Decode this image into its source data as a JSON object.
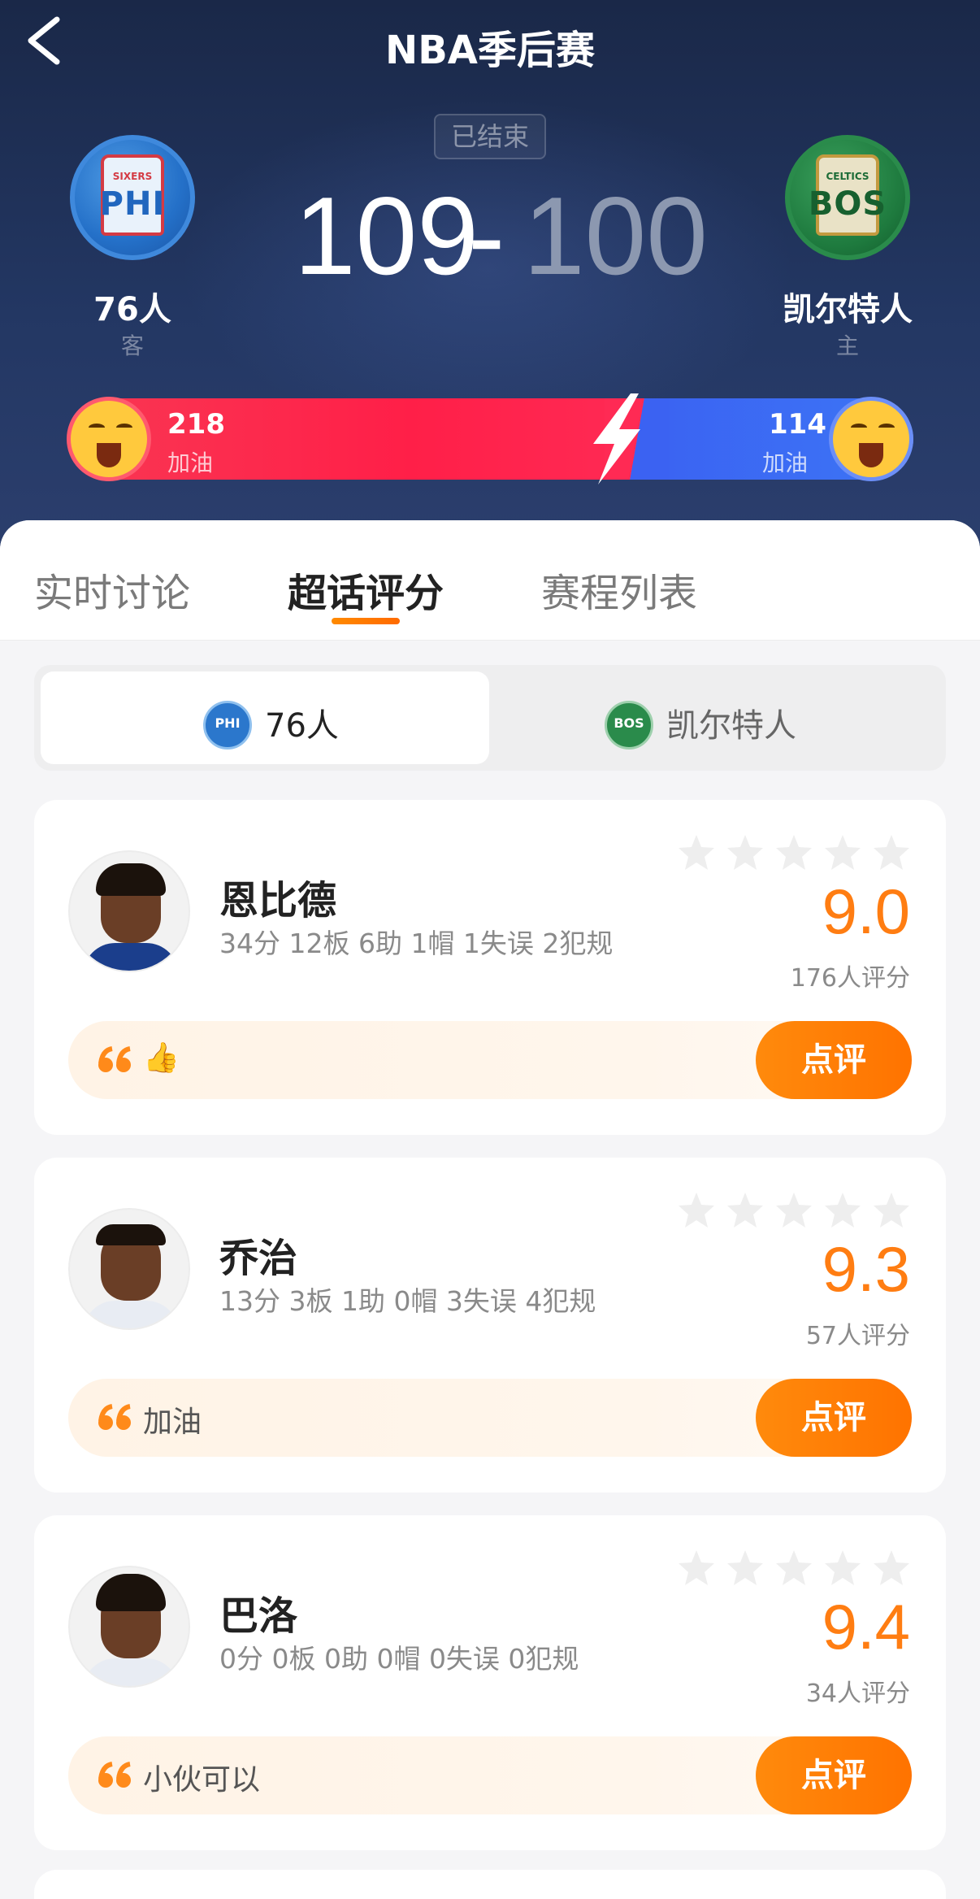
{
  "header": {
    "title": "NBA季后赛",
    "status": "已结束"
  },
  "away_team": {
    "name": "76人",
    "role": "客",
    "score": "109",
    "logo_small": "SIXERS",
    "logo_big": "PHI",
    "cheer_count": "218",
    "cheer_label": "加油"
  },
  "home_team": {
    "name": "凯尔特人",
    "role": "主",
    "score": "100",
    "logo_small": "CELTICS",
    "logo_big": "BOS",
    "cheer_count": "114",
    "cheer_label": "加油"
  },
  "score_separator": "-",
  "tabs": [
    {
      "label": "实时讨论"
    },
    {
      "label": "超话评分"
    },
    {
      "label": "赛程列表"
    }
  ],
  "team_toggle": {
    "active": "76人",
    "inactive": "凯尔特人",
    "active_mini": "PHI",
    "inactive_mini": "BOS"
  },
  "players": [
    {
      "name": "恩比德",
      "stats": "34分 12板 6助 1帽 1失误 2犯规",
      "rating": "9.0",
      "rating_count": "176人评分",
      "comment": "👍",
      "button": "点评"
    },
    {
      "name": "乔治",
      "stats": "13分 3板 1助 0帽 3失误 4犯规",
      "rating": "9.3",
      "rating_count": "57人评分",
      "comment": "加油",
      "button": "点评"
    },
    {
      "name": "巴洛",
      "stats": "0分 0板 0助 0帽 0失误 0犯规",
      "rating": "9.4",
      "rating_count": "34人评分",
      "comment": "小伙可以",
      "button": "点评"
    }
  ],
  "colors": {
    "accent_orange": "#ff7d12",
    "away_red": "#ff1f48",
    "home_blue": "#3b62f2",
    "header_navy": "#233763"
  },
  "icons": [
    "back-arrow-icon",
    "bolt-icon",
    "star-icon",
    "quote-icon",
    "cheer-emoji-icon"
  ]
}
